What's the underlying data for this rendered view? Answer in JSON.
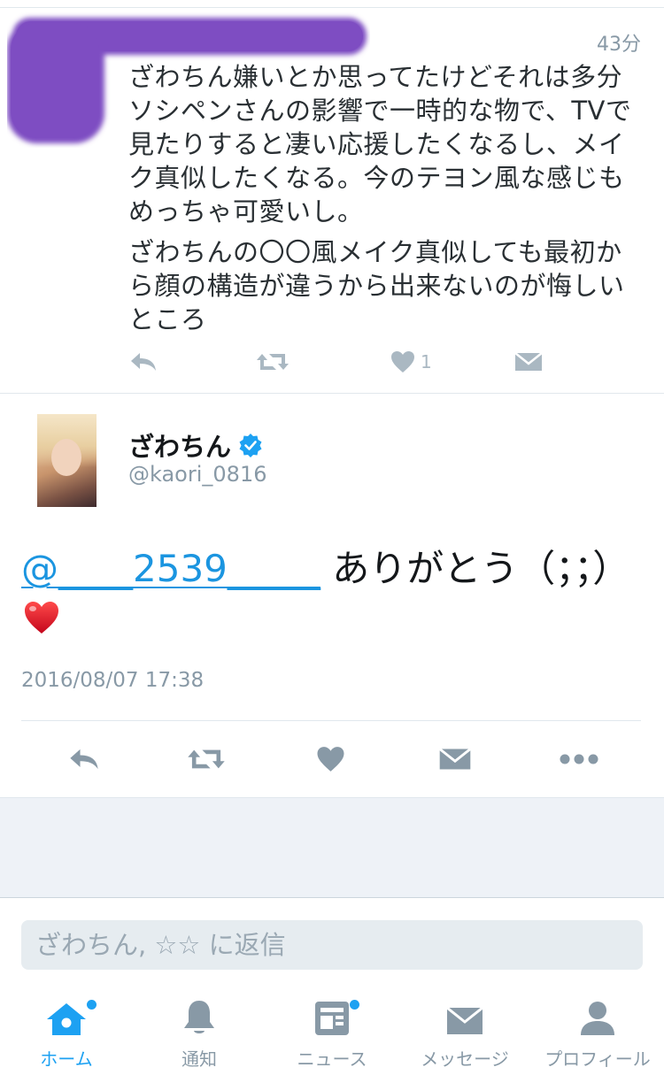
{
  "colors": {
    "accent": "#1da1f2",
    "mention": "#1b95e0",
    "gray_text": "#8899a6",
    "icon_gray": "#8899a6",
    "redaction": "#7e4dc2"
  },
  "previous_tweet": {
    "time": "43分",
    "paragraph1": "ざわちん嫌いとか思ってたけどそれは多分\nソシペンさんの影響で一時的な物で、TVで\n見たりすると凄い応援したくなるし、メイ\nク真似したくなる。今のテヨン風な感じも\nめっちゃ可愛いし。",
    "paragraph2": "ざわちんの〇〇風メイク真似しても最初か\nら顔の構造が違うから出来ないのが悔しい\nところ",
    "like_count": "1"
  },
  "main_tweet": {
    "user_name": "ざわちん",
    "handle": "@kaori_0816",
    "mention": "@____2539_____",
    "text": " ありがとう（；；）",
    "timestamp": "2016/08/07 17:38"
  },
  "reply": {
    "placeholder": "ざわちん, ☆☆ に返信"
  },
  "tabbar": {
    "home": "ホーム",
    "notifications": "通知",
    "news": "ニュース",
    "messages": "メッセージ",
    "profile": "プロフィール"
  }
}
